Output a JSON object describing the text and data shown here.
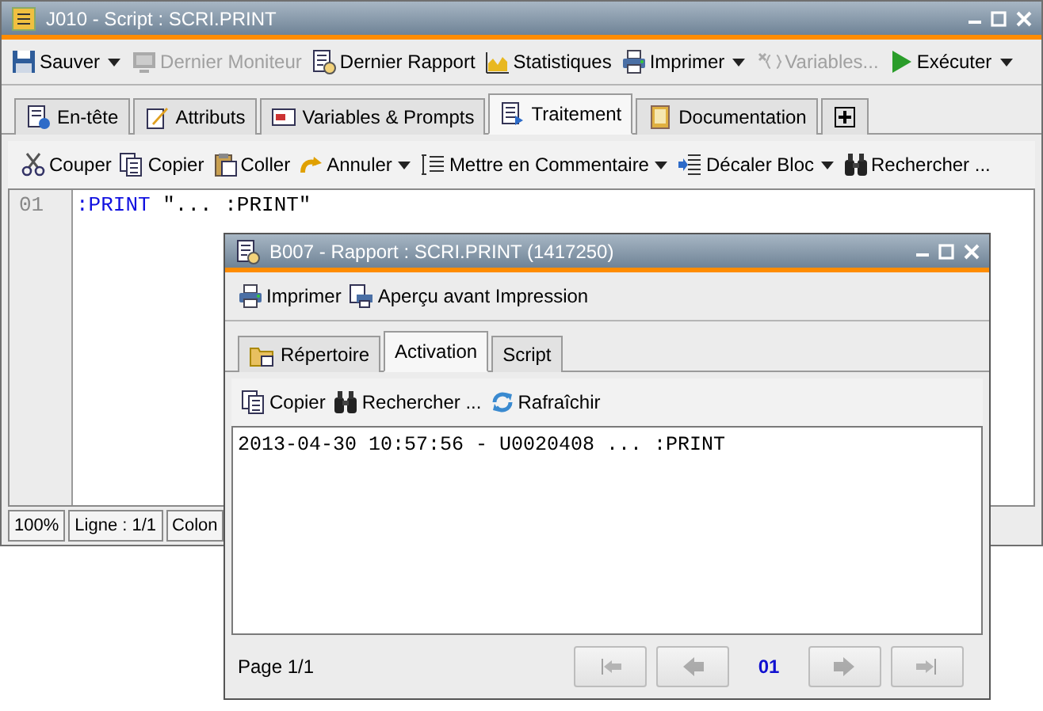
{
  "main_window": {
    "title": "J010 - Script : SCRI.PRINT",
    "toolbar": [
      {
        "label": "Sauver",
        "disabled": false,
        "dropdown": true
      },
      {
        "label": "Dernier Moniteur",
        "disabled": true,
        "dropdown": false
      },
      {
        "label": "Dernier Rapport",
        "disabled": false,
        "dropdown": false
      },
      {
        "label": "Statistiques",
        "disabled": false,
        "dropdown": false
      },
      {
        "label": "Imprimer",
        "disabled": false,
        "dropdown": true
      },
      {
        "label": "Variables...",
        "disabled": true,
        "dropdown": false
      },
      {
        "label": "Exécuter",
        "disabled": false,
        "dropdown": true
      }
    ],
    "tabs": [
      {
        "kind": "text",
        "label": "En-tête",
        "selected": false
      },
      {
        "kind": "text",
        "label": "Attributs",
        "selected": false
      },
      {
        "kind": "text",
        "label": "Variables & Prompts",
        "selected": false
      },
      {
        "kind": "text",
        "label": "Traitement",
        "selected": true
      },
      {
        "kind": "text",
        "label": "Documentation",
        "selected": false
      },
      {
        "kind": "add",
        "selected": false
      }
    ],
    "edit_toolbar": [
      {
        "label": "Couper",
        "dropdown": false
      },
      {
        "label": "Copier",
        "dropdown": false
      },
      {
        "label": "Coller",
        "dropdown": false
      },
      {
        "label": "Annuler",
        "dropdown": true
      },
      {
        "label": "Mettre en Commentaire",
        "dropdown": true
      },
      {
        "label": "Décaler Bloc",
        "dropdown": true
      },
      {
        "label": "Rechercher ...",
        "dropdown": false
      }
    ],
    "editor": {
      "lines": [
        {
          "number": "01",
          "keyword": ":PRINT",
          "text": "\"... :PRINT\""
        }
      ]
    },
    "status_bar": [
      "100%",
      "Ligne : 1/1",
      "Colon"
    ]
  },
  "dialog": {
    "title": "B007 - Rapport : SCRI.PRINT (1417250)",
    "toolbar": [
      "Imprimer",
      "Aperçu avant Impression"
    ],
    "tabs": [
      {
        "label": "Répertoire",
        "selected": false
      },
      {
        "label": "Activation",
        "selected": true
      },
      {
        "label": "Script",
        "selected": false
      }
    ],
    "output_toolbar": [
      "Copier",
      "Rechercher ...",
      "Rafraîchir"
    ],
    "output": [
      "2013-04-30 10:57:56 - U0020408 ... :PRINT"
    ],
    "page_label": "Page 1/1",
    "pager": {
      "current": "01",
      "buttons": [
        {
          "kind": "first",
          "disabled": true
        },
        {
          "kind": "previous",
          "disabled": true
        },
        {
          "kind": "next",
          "disabled": true
        },
        {
          "kind": "last",
          "disabled": true
        }
      ]
    }
  }
}
